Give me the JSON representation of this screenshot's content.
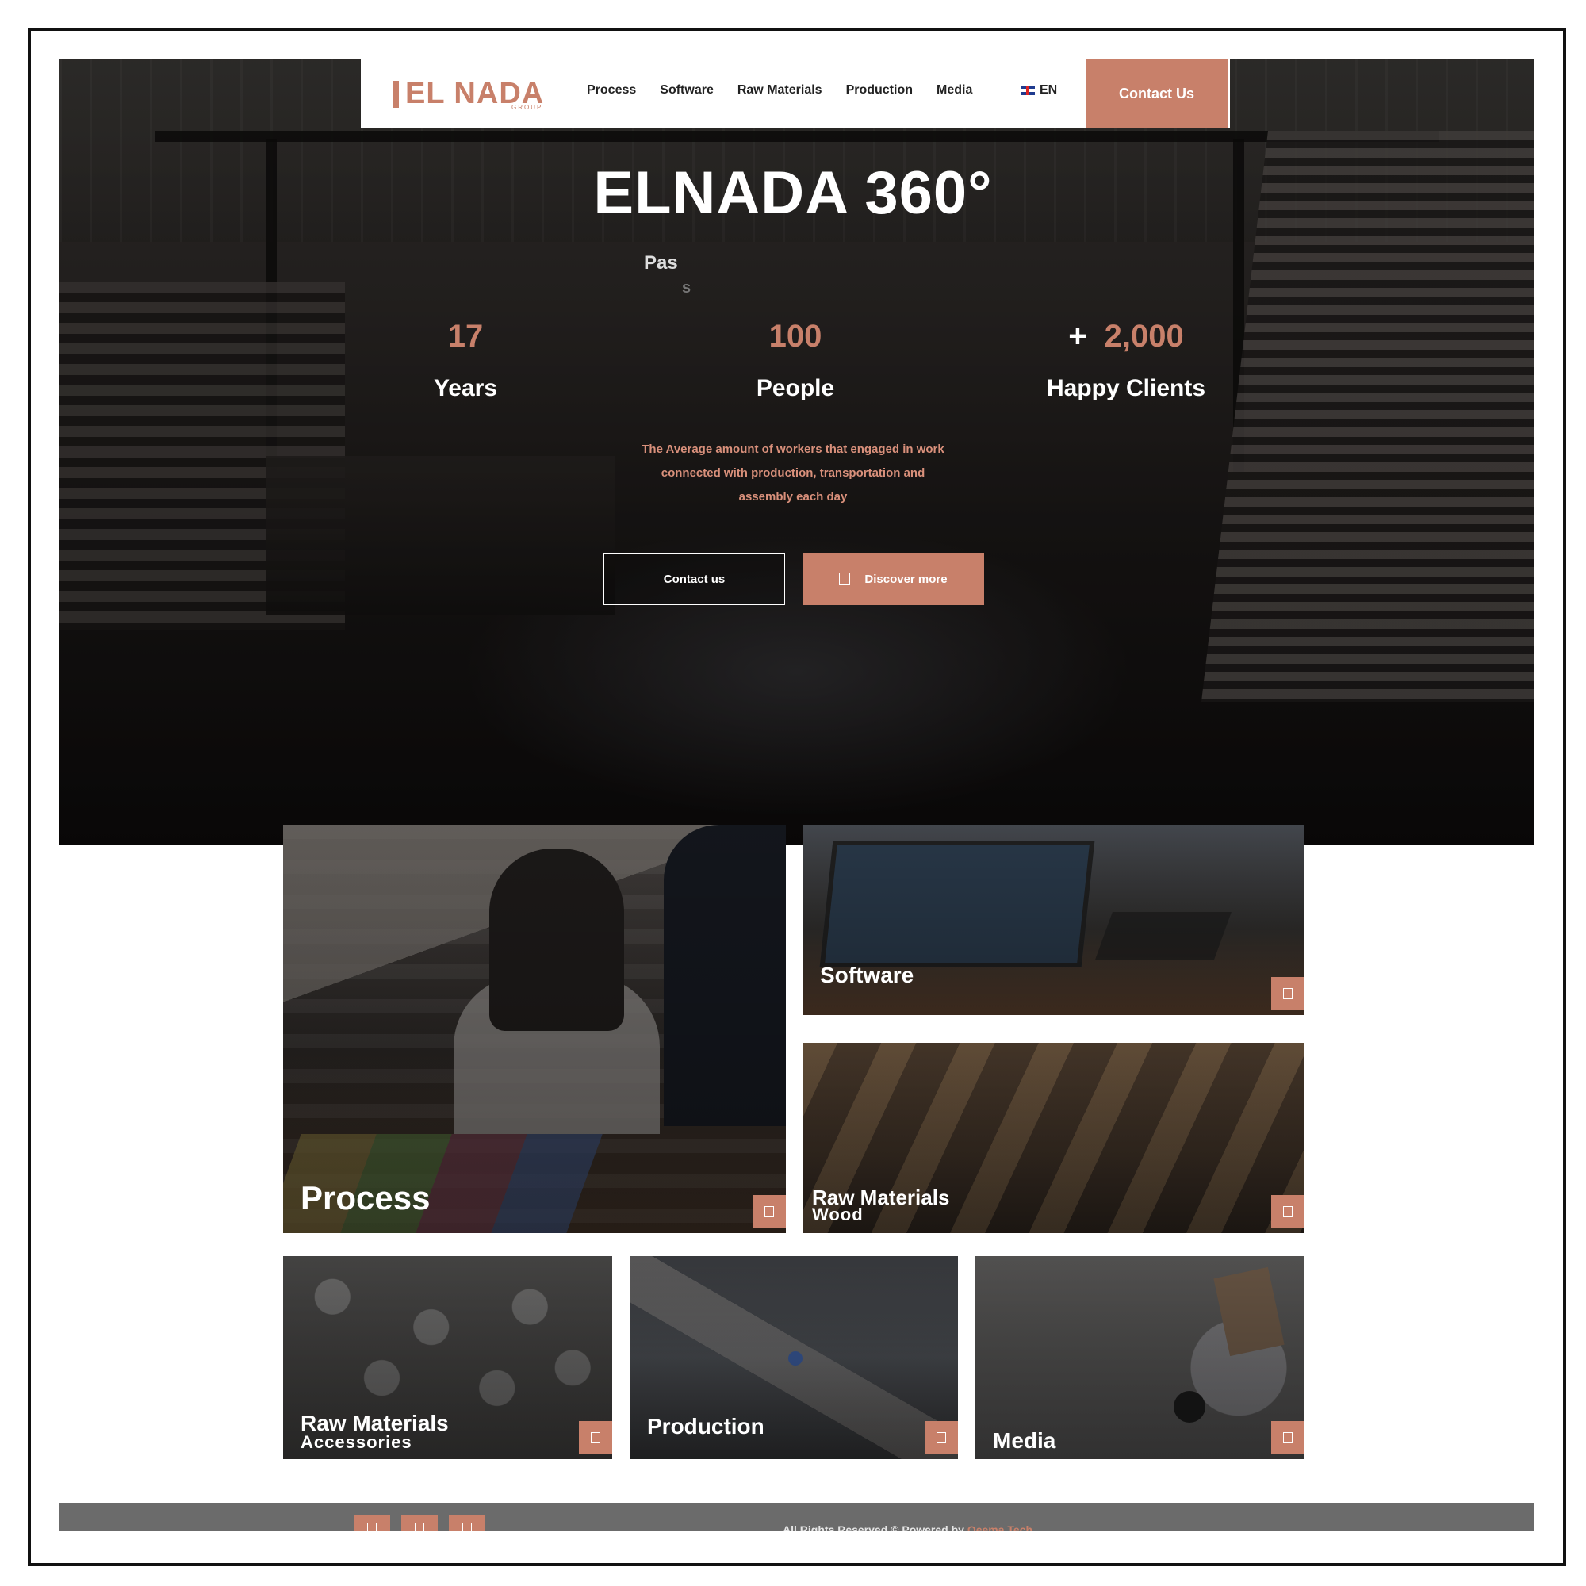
{
  "brand": {
    "logo_text": "EL NADA",
    "logo_sub": "GROUP",
    "accent": "#c8806a"
  },
  "nav": {
    "items": [
      {
        "label": "Process"
      },
      {
        "label": "Software"
      },
      {
        "label": "Raw Materials"
      },
      {
        "label": "Production"
      },
      {
        "label": "Media"
      }
    ],
    "language": "EN",
    "language_icon": "uk-flag-icon",
    "contact_label": "Contact Us"
  },
  "hero": {
    "title": "ELNADA 360°",
    "typing_text": "Pas",
    "typing_ghost": "s",
    "stats": [
      {
        "prefix": "",
        "value": "17",
        "label": "Years"
      },
      {
        "prefix": "",
        "value": "100",
        "label": "People"
      },
      {
        "prefix": "+",
        "value": "2,000",
        "label": "Happy Clients"
      }
    ],
    "description": "The Average amount of workers that engaged in work connected with production, transportation and assembly each day",
    "buttons": {
      "contact": "Contact us",
      "discover": "Discover more"
    }
  },
  "cards": [
    {
      "title": "Process",
      "subtitle": ""
    },
    {
      "title": "Software",
      "subtitle": ""
    },
    {
      "title": "Raw Materials",
      "subtitle": "Wood"
    },
    {
      "title": "Raw Materials",
      "subtitle": "Accessories"
    },
    {
      "title": "Production",
      "subtitle": ""
    },
    {
      "title": "Media",
      "subtitle": ""
    }
  ],
  "footer": {
    "social_icons": [
      "facebook-icon",
      "instagram-icon",
      "linkedin-icon"
    ],
    "copyright": "All Rights Reserved © Powered by",
    "powered_brand": "Qeema Tech"
  }
}
